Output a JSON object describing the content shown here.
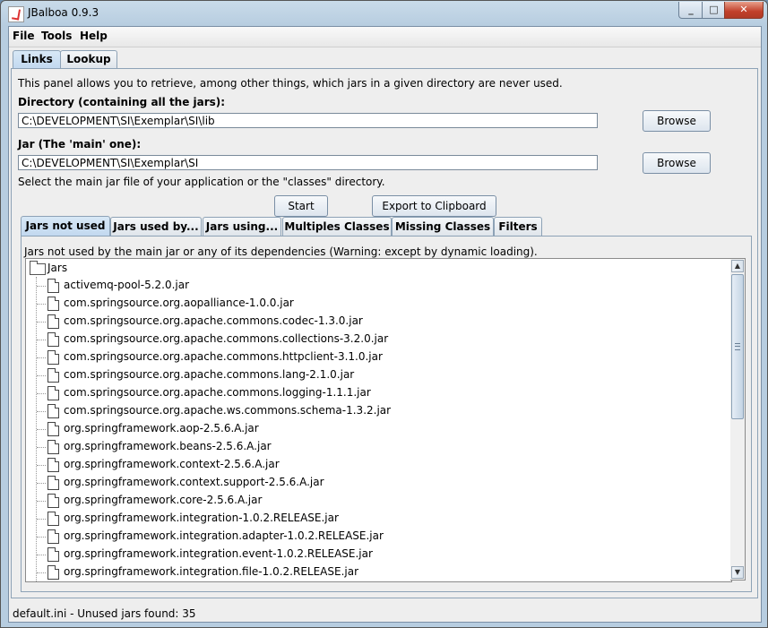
{
  "window": {
    "title": "JBalboa 0.9.3"
  },
  "menu": [
    "File",
    "Tools",
    "Help"
  ],
  "outer_tabs": [
    "Links",
    "Lookup"
  ],
  "intro": "This panel allows you to retrieve, among other things, which jars in a given directory are never used.",
  "directory": {
    "label": "Directory (containing all the jars):",
    "value": "C:\\DEVELOPMENT\\SI\\Exemplar\\SI\\lib",
    "browse": "Browse"
  },
  "jar": {
    "label": "Jar (The 'main' one):",
    "value": "C:\\DEVELOPMENT\\SI\\Exemplar\\SI",
    "browse": "Browse"
  },
  "hint": "Select the main jar file of your application or the \"classes\" directory.",
  "buttons": {
    "start": "Start",
    "export": "Export to Clipboard"
  },
  "inner_tabs": [
    "Jars not used",
    "Jars used by...",
    "Jars using...",
    "Multiples Classes",
    "Missing Classes",
    "Filters"
  ],
  "inner_desc": "Jars not used by the main jar or any of its dependencies (Warning: except by dynamic loading).",
  "tree": {
    "root": "Jars",
    "items": [
      "activemq-pool-5.2.0.jar",
      "com.springsource.org.aopalliance-1.0.0.jar",
      "com.springsource.org.apache.commons.codec-1.3.0.jar",
      "com.springsource.org.apache.commons.collections-3.2.0.jar",
      "com.springsource.org.apache.commons.httpclient-3.1.0.jar",
      "com.springsource.org.apache.commons.lang-2.1.0.jar",
      "com.springsource.org.apache.commons.logging-1.1.1.jar",
      "com.springsource.org.apache.ws.commons.schema-1.3.2.jar",
      "org.springframework.aop-2.5.6.A.jar",
      "org.springframework.beans-2.5.6.A.jar",
      "org.springframework.context-2.5.6.A.jar",
      "org.springframework.context.support-2.5.6.A.jar",
      "org.springframework.core-2.5.6.A.jar",
      "org.springframework.integration-1.0.2.RELEASE.jar",
      "org.springframework.integration.adapter-1.0.2.RELEASE.jar",
      "org.springframework.integration.event-1.0.2.RELEASE.jar",
      "org.springframework.integration.file-1.0.2.RELEASE.jar"
    ]
  },
  "status": "default.ini - Unused jars found: 35"
}
